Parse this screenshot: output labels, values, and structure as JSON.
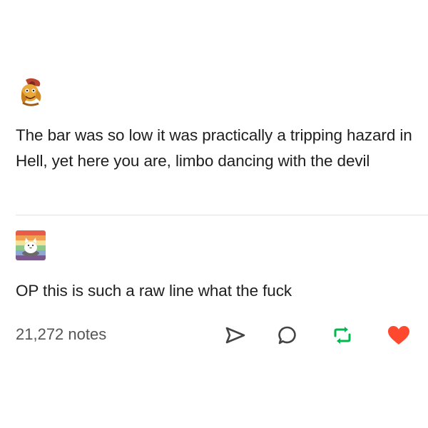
{
  "original_post": {
    "text": "The bar was so low it was practically a tripping hazard in Hell, yet here you are, limbo dancing with the devil",
    "avatar_icon": "mascot-avatar-icon"
  },
  "reply_post": {
    "text": "OP this is such a raw line what the fuck",
    "avatar_icon": "cat-avatar-icon"
  },
  "footer": {
    "notes_label": "21,272 notes",
    "actions": {
      "share_icon": "share-icon",
      "reply_icon": "reply-icon",
      "reblog_icon": "reblog-icon",
      "like_icon": "heart-icon"
    }
  },
  "colors": {
    "text": "#1e1e1e",
    "notes_text": "#555555",
    "reblog_green": "#00b84f",
    "like_red": "#ff492f",
    "divider": "#e3e3e3"
  }
}
